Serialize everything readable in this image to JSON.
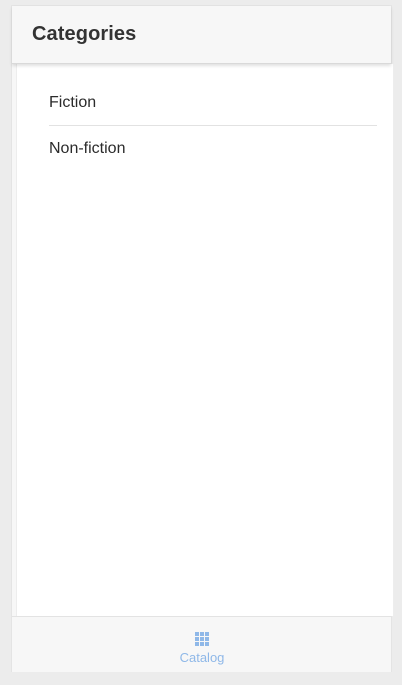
{
  "header": {
    "title": "Categories"
  },
  "categories": [
    {
      "label": "Fiction"
    },
    {
      "label": "Non-fiction"
    }
  ],
  "tabbar": {
    "tabs": [
      {
        "label": "Catalog",
        "icon": "grid-icon",
        "active": true
      }
    ]
  },
  "colors": {
    "accent": "#8fb8e8"
  }
}
